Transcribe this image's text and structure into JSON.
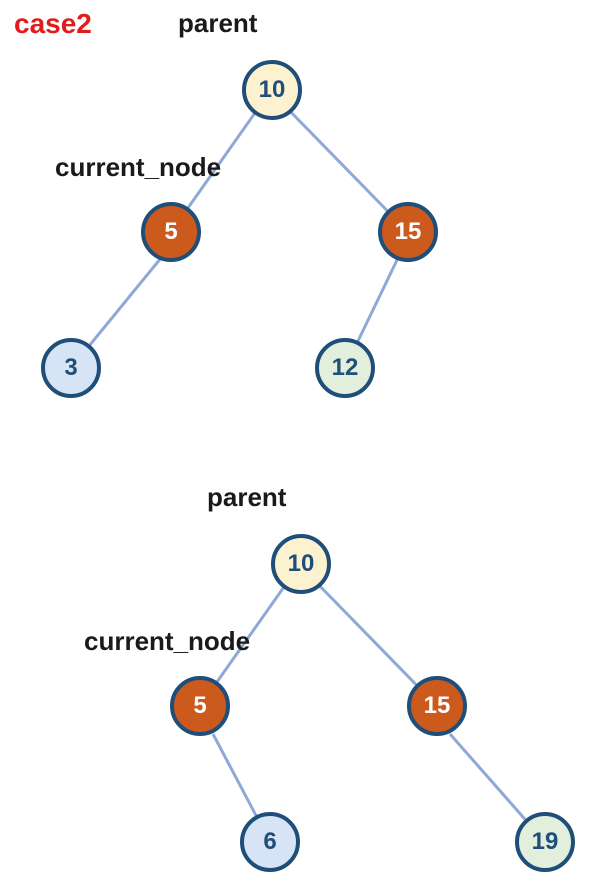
{
  "title": "case2",
  "labels": {
    "parent": "parent",
    "current_node": "current_node"
  },
  "colors": {
    "title": "#e31b1b",
    "node_border": "#1f4e79",
    "edge": "#8fa9d6",
    "fill_cream": "#fdf2cf",
    "fill_orange": "#cc5a1d",
    "fill_blue": "#d6e4f5",
    "fill_green": "#e1efdc"
  },
  "chart_data": [
    {
      "type": "tree",
      "title": "case2",
      "root_label": "parent",
      "highlighted_label": "current_node",
      "nodes": [
        {
          "id": "10",
          "value": 10,
          "fill": "cream",
          "role": "parent"
        },
        {
          "id": "5",
          "value": 5,
          "fill": "orange",
          "role": "current_node"
        },
        {
          "id": "15",
          "value": 15,
          "fill": "orange"
        },
        {
          "id": "3",
          "value": 3,
          "fill": "blue"
        },
        {
          "id": "12",
          "value": 12,
          "fill": "green"
        }
      ],
      "edges": [
        [
          "10",
          "5"
        ],
        [
          "10",
          "15"
        ],
        [
          "5",
          "3"
        ],
        [
          "15",
          "12"
        ]
      ]
    },
    {
      "type": "tree",
      "root_label": "parent",
      "highlighted_label": "current_node",
      "nodes": [
        {
          "id": "10",
          "value": 10,
          "fill": "cream",
          "role": "parent"
        },
        {
          "id": "5",
          "value": 5,
          "fill": "orange",
          "role": "current_node"
        },
        {
          "id": "15",
          "value": 15,
          "fill": "orange"
        },
        {
          "id": "6",
          "value": 6,
          "fill": "blue"
        },
        {
          "id": "19",
          "value": 19,
          "fill": "green"
        }
      ],
      "edges": [
        [
          "10",
          "5"
        ],
        [
          "10",
          "15"
        ],
        [
          "5",
          "6"
        ],
        [
          "15",
          "19"
        ]
      ]
    }
  ]
}
